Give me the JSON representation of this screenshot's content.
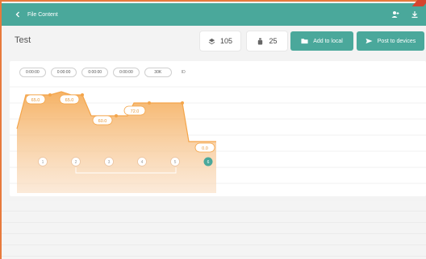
{
  "appbar": {
    "title": "File Content",
    "back_icon": "chevron-left-icon",
    "icons": [
      "person-add-icon",
      "download-icon"
    ]
  },
  "toolbar": {
    "name": "Test",
    "stat1": {
      "icon": "layers-icon",
      "value": "105"
    },
    "stat2": {
      "icon": "bottle-icon",
      "value": "25"
    },
    "add_local": "Add to local",
    "post_devices": "Post to devices"
  },
  "segments": [
    "0:00:00",
    "0:00:00",
    "0:00:00",
    "0:00:00",
    "30K"
  ],
  "segments_tail": "ID",
  "profile": {
    "labels": [
      "65.0",
      "65.0",
      "60.0",
      "72.0",
      "0.0"
    ],
    "points": [
      "1",
      "2",
      "3",
      "4",
      "5",
      "6"
    ],
    "accent": "#f4a54a",
    "active_point_color": "#4aa89b"
  },
  "colors": {
    "brand": "#4aa89b",
    "accent": "#f4a54a",
    "border": "#e87a3c"
  }
}
